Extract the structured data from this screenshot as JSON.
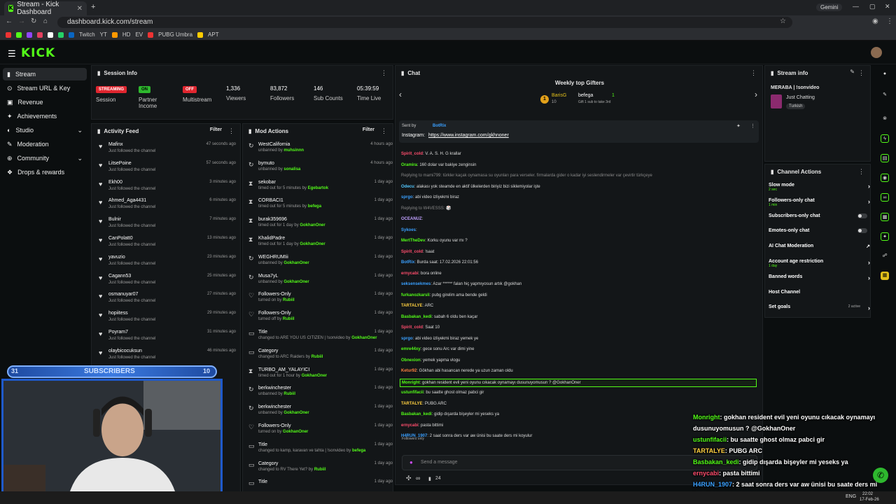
{
  "browser": {
    "tab_title": "Stream - Kick Dashboard",
    "url": "dashboard.kick.com/stream",
    "profile_label": "Gemini",
    "bookmarks": [
      "Twitch",
      "YT",
      "HD",
      "EV",
      "PUBG Umbra",
      "APT"
    ]
  },
  "brand": {
    "logo": "KICK",
    "accent": "#53fc18"
  },
  "sidebar": {
    "items": [
      {
        "label": "Stream"
      },
      {
        "label": "Stream URL & Key"
      },
      {
        "label": "Revenue"
      },
      {
        "label": "Achievements"
      },
      {
        "label": "Studio"
      },
      {
        "label": "Moderation"
      },
      {
        "label": "Community"
      },
      {
        "label": "Drops & rewards"
      }
    ]
  },
  "session": {
    "title": "Session Info",
    "status_badge": "STREAMING",
    "status_label": "Session",
    "partner_badge": "ON",
    "partner_label": "Partner Income",
    "multistream_badge": "OFF",
    "multistream_label": "Multistream",
    "viewers": "1,336",
    "viewers_label": "Viewers",
    "followers": "83,872",
    "followers_label": "Followers",
    "subs": "146",
    "subs_label": "Sub Counts",
    "time": "05:39:59",
    "time_label": "Time Live"
  },
  "activity": {
    "title": "Activity Feed",
    "filter": "Filter",
    "items": [
      {
        "name": "Mafinx",
        "sub": "Just followed the channel",
        "time": "47 seconds ago"
      },
      {
        "name": "LitsePoine",
        "sub": "Just followed the channel",
        "time": "57 seconds ago"
      },
      {
        "name": "Ekh00",
        "sub": "Just followed the channel",
        "time": "3 minutes ago"
      },
      {
        "name": "Ahmed_Aga4431",
        "sub": "Just followed the channel",
        "time": "6 minutes ago"
      },
      {
        "name": "Bulnir",
        "sub": "Just followed the channel",
        "time": "7 minutes ago"
      },
      {
        "name": "CanPolatt0",
        "sub": "Just followed the channel",
        "time": "13 minutes ago"
      },
      {
        "name": "yavuzio",
        "sub": "Just followed the channel",
        "time": "23 minutes ago"
      },
      {
        "name": "Cagann53",
        "sub": "Just followed the channel",
        "time": "25 minutes ago"
      },
      {
        "name": "osmanuyar07",
        "sub": "Just followed the channel",
        "time": "27 minutes ago"
      },
      {
        "name": "hopiitess",
        "sub": "Just followed the channel",
        "time": "29 minutes ago"
      },
      {
        "name": "Poyram7",
        "sub": "Just followed the channel",
        "time": "31 minutes ago"
      },
      {
        "name": "olaybicocuksun",
        "sub": "Just followed the channel",
        "time": "46 minutes ago"
      }
    ]
  },
  "subs_widget": {
    "left": "31",
    "label": "SUBSCRIBERS",
    "right": "10"
  },
  "mod": {
    "title": "Mod Actions",
    "filter": "Filter",
    "items": [
      {
        "icon": "↻",
        "name": "WestCalifornia",
        "pre": "unbanned by ",
        "by": "muhsinnn",
        "time": "4 hours ago"
      },
      {
        "icon": "↻",
        "name": "bymuto",
        "pre": "unbanned by ",
        "by": "sonalisa",
        "time": "4 hours ago"
      },
      {
        "icon": "⧗",
        "name": "sekobar",
        "pre": "timed out for 5 minutes by ",
        "by": "Egebartok",
        "time": "1 day ago"
      },
      {
        "icon": "⧗",
        "name": "CORBACI1",
        "pre": "timed out for 5 minutes by ",
        "by": "befega",
        "time": "1 day ago"
      },
      {
        "icon": "⧗",
        "name": "burak359696",
        "pre": "timed out for 1 day by ",
        "by": "GokhanOner",
        "time": "1 day ago"
      },
      {
        "icon": "⧗",
        "name": "KhalidPadre",
        "pre": "timed out for 1 day by ",
        "by": "GokhanOner",
        "time": "1 day ago"
      },
      {
        "icon": "↻",
        "name": "WEGHRUMIii",
        "pre": "unbanned by ",
        "by": "GokhanOner",
        "time": "1 day ago"
      },
      {
        "icon": "↻",
        "name": "Musa7yL",
        "pre": "unbanned by ",
        "by": "GokhanOner",
        "time": "1 day ago"
      },
      {
        "icon": "♡",
        "name": "Followers-Only",
        "pre": "turned on by ",
        "by": "Rubiil",
        "time": "1 day ago"
      },
      {
        "icon": "♡",
        "name": "Followers-Only",
        "pre": "turned off by ",
        "by": "Rubiil",
        "time": "1 day ago"
      },
      {
        "icon": "▭",
        "name": "Title",
        "pre": "changed to ARE YOU US CITIZEN | !sonvideo by ",
        "by": "GokhanOner",
        "time": "1 day ago"
      },
      {
        "icon": "▭",
        "name": "Category",
        "pre": "changed to ARC Raiders by ",
        "by": "Rubiil",
        "time": "1 day ago"
      },
      {
        "icon": "⧗",
        "name": "TURBO_AM_YALAYICI",
        "pre": "timed out for 1 hour by ",
        "by": "GokhanOner",
        "time": "1 day ago"
      },
      {
        "icon": "↻",
        "name": "berkwinchester",
        "pre": "unbanned by ",
        "by": "Rubiil",
        "time": "1 day ago"
      },
      {
        "icon": "↻",
        "name": "berkwinchester",
        "pre": "unbanned by ",
        "by": "GokhanOner",
        "time": "1 day ago"
      },
      {
        "icon": "♡",
        "name": "Followers-Only",
        "pre": "turned on by ",
        "by": "GokhanOner",
        "time": "1 day ago"
      },
      {
        "icon": "▭",
        "name": "Title",
        "pre": "changed to kamp, karavan ve tahta | !sonvideo by ",
        "by": "befega",
        "time": "1 day ago"
      },
      {
        "icon": "▭",
        "name": "Category",
        "pre": "changed to RV There Yet? by ",
        "by": "Rubiil",
        "time": "1 day ago"
      },
      {
        "icon": "▭",
        "name": "Title",
        "pre": "",
        "by": "",
        "time": "1 day ago"
      }
    ]
  },
  "chat": {
    "title": "Chat",
    "gifters_title": "Weekly top Gifters",
    "gifter1": "BarisG",
    "gifter1_count": "10",
    "gifter2": "befega",
    "gifter2_count": "1",
    "gifter2_note": "Gift 1 sub to take 3rd",
    "pinned_sender": "Sent by",
    "pinned_bot": "BotRix",
    "pinned_text": "Instagram:",
    "pinned_link": "https://www.instagram.com/gkhnoner",
    "messages": [
      {
        "user": "Spirit_cold",
        "color": "#ff4d6d",
        "text": ": V. A. S. H. G krallar"
      },
      {
        "user": "Oramira",
        "color": "#53fc18",
        "text": ": 160 dolar var bakiye zenginsin"
      },
      {
        "user": "",
        "color": "#888",
        "text": "Replying to mami799: türkler kaçak oynamasa su oyunları para verseler. firmalarda gider o kadar iyi seslendirmeler var çevirtir türkçeye"
      },
      {
        "user": "Odecu",
        "color": "#53c8ff",
        "text": ": alakası yok steamde en aktif ülkelerden biriyiz bizi siklemiyolar işte"
      },
      {
        "user": "sprgo",
        "color": "#3aa0ff",
        "text": ": abi video izliyekmi biraz"
      },
      {
        "user": "",
        "color": "#888",
        "text": "Replying to W4VESSS: 🎲"
      },
      {
        "user": "OCEANUZ",
        "color": "#c0a0ff",
        "text": ":"
      },
      {
        "user": "Sykoes",
        "color": "#3aa0ff",
        "text": ":"
      },
      {
        "user": "MertTheDev",
        "color": "#53fc18",
        "text": ": Korku oyunu var mı ?"
      },
      {
        "user": "Spirit_cold",
        "color": "#ff4d6d",
        "text": ": !saat"
      },
      {
        "user": "BotRix",
        "color": "#3aa0ff",
        "text": ": Burda saat: 17.02.2026 22:01:56"
      },
      {
        "user": "ernycabi",
        "color": "#ff4d6d",
        "text": ": bora online"
      },
      {
        "user": "seksensekmes",
        "color": "#3aa0ff",
        "text": ": Azar ****** falan hiç yapmıyosun artık @gokhan"
      },
      {
        "user": "furkanozkarsli",
        "color": "#53fc18",
        "text": ": pubg girelim ama bende geldi"
      },
      {
        "user": "TARTALYE",
        "color": "#ffd040",
        "text": ": ARC"
      },
      {
        "user": "Basbakan_kedi",
        "color": "#53fc18",
        "text": ": sabah 6 oldu ben kaçar"
      },
      {
        "user": "Spirit_cold",
        "color": "#ff4d6d",
        "text": ": Saat 10"
      },
      {
        "user": "sprgo",
        "color": "#3aa0ff",
        "text": ": abi video izliyekmi biraz yemek ye"
      },
      {
        "user": "emre44xy",
        "color": "#53fc18",
        "text": ": gece sonu Arc var dimi yine"
      },
      {
        "user": "Obnexion",
        "color": "#53fc18",
        "text": ": yemek yapma vlogu"
      },
      {
        "user": "Ketur92",
        "color": "#ff8040",
        "text": ": Gökhan abi hasancan nerede ya uzun zaman oldu"
      },
      {
        "user": "Monright",
        "color": "#53fc18",
        "text": ": gokhan resident evil yeni oyunu cıkacak oynamayı dusunuyomusun ? @GokhanOner"
      },
      {
        "user": "ustunfifacii",
        "color": "#53fc18",
        "text": ": bu saatte ghost olmaz pabci gir"
      },
      {
        "user": "TARTALYE",
        "color": "#ffd040",
        "text": ": PUBG ARC"
      },
      {
        "user": "Basbakan_kedi",
        "color": "#53fc18",
        "text": ": gidip dışarda bişeyler mi yeseks ya"
      },
      {
        "user": "ernycabi",
        "color": "#ff4d6d",
        "text": ": pasta bittimi"
      },
      {
        "user": "H4RUN_1907",
        "color": "#3aa0ff",
        "text": ": 2 saat sonra ders var aw ünisi bu saate ders mi koyulur"
      }
    ],
    "followers_only": "Followers only",
    "input_placeholder": "Send a message",
    "char_count": "24"
  },
  "stream_info": {
    "title": "Stream info",
    "stream_title": "MERABA | !sonvideo",
    "category": "Just Chatting",
    "language": "Turkish"
  },
  "channel_actions": {
    "title": "Channel Actions",
    "items": [
      {
        "label": "Slow mode",
        "sub": "2 sec",
        "ctl": "arrow"
      },
      {
        "label": "Followers-only chat",
        "sub": "1 min",
        "ctl": "arrow"
      },
      {
        "label": "Subscribers-only chat",
        "sub": "",
        "ctl": "toggle"
      },
      {
        "label": "Emotes-only chat",
        "sub": "",
        "ctl": "toggle"
      },
      {
        "label": "AI Chat Moderation",
        "sub": "",
        "ctl": "ext"
      },
      {
        "label": "Account age restriction",
        "sub": "1 day",
        "ctl": "arrow"
      },
      {
        "label": "Banned words",
        "sub": "",
        "ctl": "arrow"
      },
      {
        "label": "Host Channel",
        "sub": "",
        "ctl": ""
      },
      {
        "label": "Set goals",
        "sub": "",
        "ctl": "arrow",
        "badge": "2 active"
      }
    ]
  },
  "overlay_chat": [
    {
      "user": "Monright",
      "color": "#53fc18",
      "text": ": gokhan resident evil yeni oyunu cıkacak oynamayı"
    },
    {
      "user": "",
      "color": "#fff",
      "text": "dusunuyomusun ? @GokhanOner"
    },
    {
      "user": "ustunfifacii",
      "color": "#53fc18",
      "text": ": bu saatte ghost olmaz pabci gir"
    },
    {
      "user": "TARTALYE",
      "color": "#ffd040",
      "text": ": PUBG ARC"
    },
    {
      "user": "Basbakan_kedi",
      "color": "#53fc18",
      "text": ": gidip dışarda bişeyler mi yeseks ya"
    },
    {
      "user": "ernycabi",
      "color": "#ff4d6d",
      "text": ": pasta bittimi"
    },
    {
      "user": "H4RUN_1907",
      "color": "#3aa0ff",
      "text": ": 2 saat sonra ders var aw ünisi bu saate ders mi"
    },
    {
      "user": "",
      "color": "#fff",
      "text": "koyulur"
    }
  ],
  "taskbar": {
    "lang": "ENG",
    "time": "22:02",
    "date": "17-Feb-26"
  }
}
